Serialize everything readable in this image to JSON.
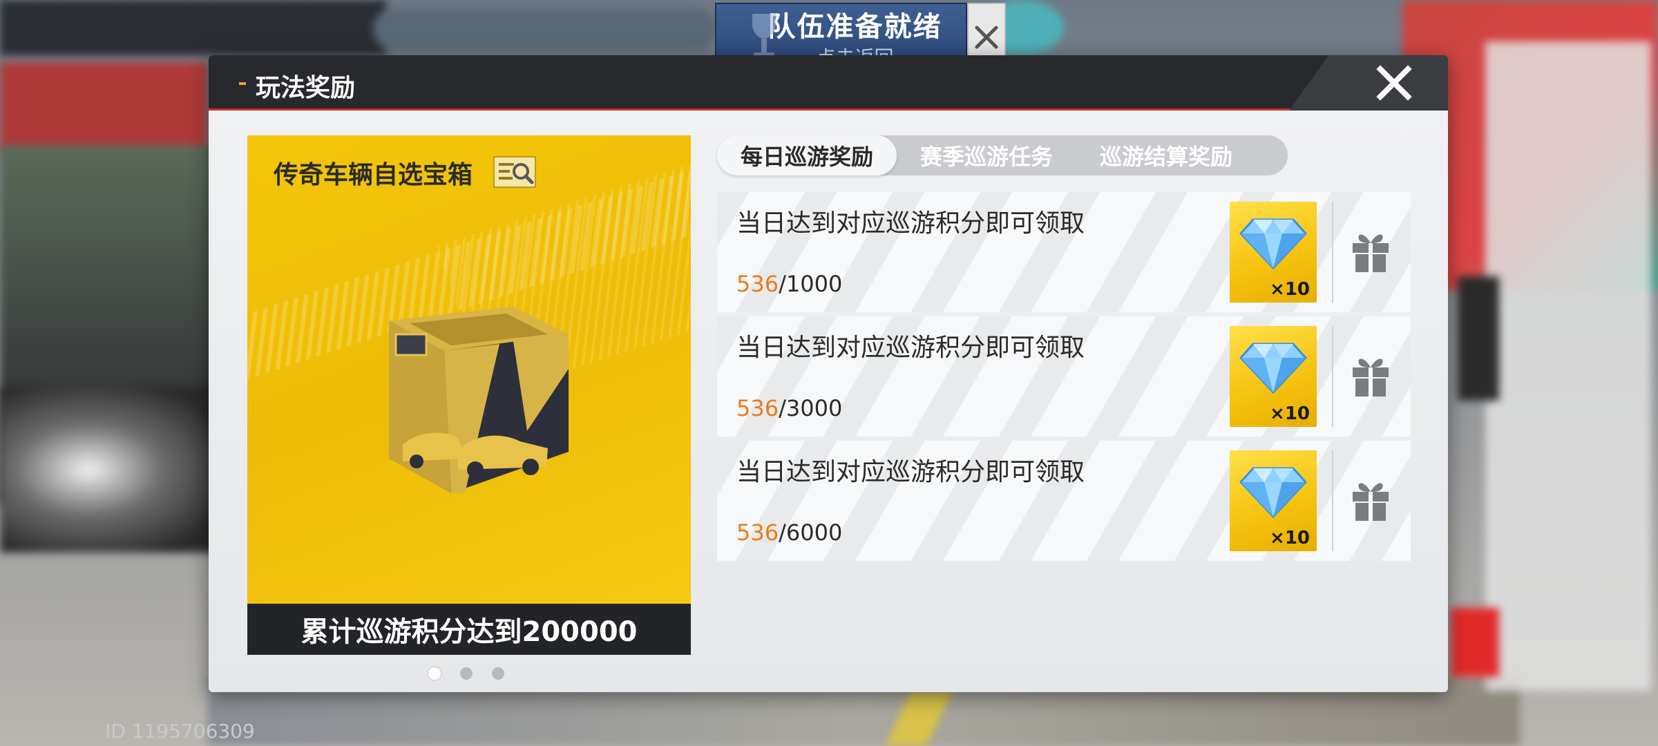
{
  "team_banner": {
    "title": "队伍准备就绪",
    "subtitle": "点击返回"
  },
  "modal": {
    "title": "玩法奖励"
  },
  "chest": {
    "title": "传奇车辆自选宝箱",
    "footer": "累计巡游积分达到200000"
  },
  "carousel": {
    "page_count": 3,
    "active_index": 0
  },
  "tabs": [
    {
      "label": "每日巡游奖励",
      "active": true
    },
    {
      "label": "赛季巡游任务",
      "active": false
    },
    {
      "label": "巡游结算奖励",
      "active": false
    }
  ],
  "rewards": [
    {
      "desc": "当日达到对应巡游积分即可领取",
      "current": "536",
      "target": "/1000",
      "count": "×10",
      "icon": "diamond-icon"
    },
    {
      "desc": "当日达到对应巡游积分即可领取",
      "current": "536",
      "target": "/3000",
      "count": "×10",
      "icon": "diamond-icon"
    },
    {
      "desc": "当日达到对应巡游积分即可领取",
      "current": "536",
      "target": "/6000",
      "count": "×10",
      "icon": "diamond-icon"
    }
  ],
  "player_id": "ID 1195706309",
  "colors": {
    "accent_orange": "#ee7a1b",
    "header_red": "#d22b2b",
    "chest_yellow": "#f2c60a"
  }
}
